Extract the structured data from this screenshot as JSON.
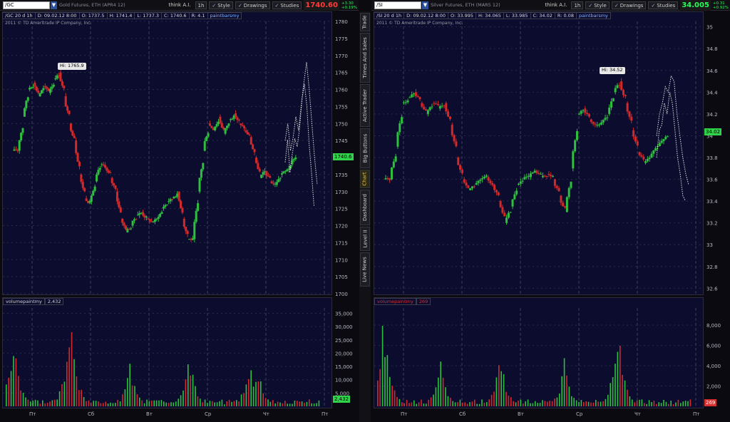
{
  "colors": {
    "up": "#2fbf3f",
    "down": "#d22a2a",
    "grid": "#3e3e5a",
    "projection": "#e0e0e0",
    "last_up": "#22ff55",
    "last_red": "#ff3b3b",
    "badge_green": "#2fd44a",
    "badge_red": "#d83030"
  },
  "toolbar_common": {
    "share_label": "think A.I.",
    "timeframe": "1h",
    "style": "Style",
    "drawings": "Drawings",
    "studies": "Studies"
  },
  "side_tabs": [
    "Trade",
    "Times And Sales",
    "Active Trader",
    "Big Buttons",
    "Chart",
    "Dashboard",
    "Level II",
    "Live News"
  ],
  "active_tab": "Chart",
  "left": {
    "symbol": "/GC",
    "description": "Gold Futures, ETH (APR4 12)",
    "last_price": "1740.60",
    "change_top": "+3.30",
    "change_bottom": "+0.19%",
    "info": [
      "/GC 20 d 1h",
      "D: 09.02.12 8:00",
      "O: 1737.5",
      "H: 1741.4",
      "L: 1737.3",
      "C: 1740.6",
      "R: 4.1",
      "paintbarsmy"
    ],
    "copyright": "2011 © TD Ameritrade IP Company, Inc.",
    "price_badge": "1740.6",
    "hi_label": "Hi: 1765.9",
    "volume_label": "volumepaintmy",
    "volume_value": "2,432",
    "volume_badge": "2,432",
    "price_ticks": [
      "1780",
      "1775",
      "1770",
      "1765",
      "1760",
      "1755",
      "1750",
      "1745",
      "1740",
      "1735",
      "1730",
      "1725",
      "1720",
      "1715",
      "1710",
      "1705",
      "1700"
    ],
    "volume_ticks": [
      "35,000",
      "30,000",
      "25,000",
      "20,000",
      "15,000",
      "10,000",
      "5,000"
    ],
    "day_labels": [
      "Пт",
      "Сб",
      "Вт",
      "Ср",
      "Чт",
      "Пт"
    ]
  },
  "right": {
    "symbol": "/SI",
    "description": "Silver Futures, ETH (MAR5 12)",
    "last_price": "34.005",
    "change_top": "+0.31",
    "change_bottom": "+0.92%",
    "info": [
      "/SI 20 d 1h",
      "D: 09.02.12 8:00",
      "O: 33.995",
      "H: 34.065",
      "L: 33.985",
      "C: 34.02",
      "R: 0.08",
      "paintbarsmy"
    ],
    "copyright": "2011 © TD Ameritrade IP Company, Inc.",
    "price_badge": "34.02",
    "hi_label": "Hi: 34.52",
    "volume_label": "volumepaintmy",
    "volume_value": "269",
    "volume_badge": "269",
    "price_ticks": [
      "35",
      "34.8",
      "34.6",
      "34.4",
      "34.2",
      "34",
      "33.8",
      "33.6",
      "33.4",
      "33.2",
      "33",
      "32.8",
      "32.6"
    ],
    "volume_ticks": [
      "8,000",
      "6,000",
      "4,000",
      "2,000"
    ],
    "day_labels": [
      "Пт",
      "Сб",
      "Вт",
      "Ср",
      "Чт",
      "Пт"
    ]
  },
  "chart_data": [
    {
      "type": "candlestick",
      "symbol": "/GC",
      "ylim": [
        1700,
        1780
      ],
      "y_ticks": [
        1700,
        1705,
        1710,
        1715,
        1720,
        1725,
        1730,
        1735,
        1740,
        1745,
        1750,
        1755,
        1760,
        1765,
        1770,
        1775,
        1780
      ],
      "close_path": [
        1742,
        1752,
        1760,
        1762,
        1758,
        1761,
        1759,
        1763,
        1765,
        1758,
        1750,
        1745,
        1735,
        1728,
        1727,
        1733,
        1738,
        1737,
        1734,
        1730,
        1722,
        1718,
        1720,
        1723,
        1724,
        1722,
        1721,
        1722,
        1725,
        1727,
        1728,
        1730,
        1722,
        1716,
        1716,
        1730,
        1742,
        1750,
        1748,
        1752,
        1747,
        1751,
        1753,
        1750,
        1748,
        1746,
        1740,
        1734,
        1736,
        1733,
        1732,
        1735,
        1736,
        1738,
        1741
      ],
      "projection": [
        1745,
        1750,
        1742,
        1746,
        1752,
        1748,
        1755,
        1762,
        1768,
        1760,
        1750,
        1740,
        1732
      ],
      "hi": 1765.9,
      "last": 1740.6,
      "volume_ylim": [
        0,
        37000
      ],
      "volume_spikes": [
        30000,
        32000,
        35000,
        18000,
        22000,
        21000,
        15000
      ]
    },
    {
      "type": "candlestick",
      "symbol": "/SI",
      "ylim": [
        32.55,
        35.05
      ],
      "y_ticks": [
        32.6,
        32.8,
        33,
        33.2,
        33.4,
        33.6,
        33.8,
        34,
        34.2,
        34.4,
        34.6,
        34.8,
        35
      ],
      "close_path": [
        33.6,
        33.9,
        34.3,
        34.35,
        34.4,
        34.3,
        34.2,
        34.3,
        34.25,
        34.3,
        34.1,
        33.8,
        33.6,
        33.5,
        33.55,
        33.6,
        33.62,
        33.55,
        33.4,
        33.2,
        33.35,
        33.55,
        33.6,
        33.62,
        33.68,
        33.62,
        33.65,
        33.6,
        33.45,
        33.3,
        33.7,
        34.2,
        34.25,
        34.15,
        34.1,
        34.12,
        34.2,
        34.4,
        34.5,
        34.3,
        34.05,
        33.85,
        33.75,
        33.8,
        33.9,
        33.95,
        34.02
      ],
      "projection": [
        34.0,
        34.2,
        34.3,
        34.45,
        34.4,
        34.55,
        34.5,
        34.2,
        34.0,
        33.8,
        33.65,
        33.55
      ],
      "hi": 34.52,
      "last": 34.02,
      "volume_ylim": [
        0,
        9700
      ],
      "volume_spikes": [
        8800,
        6200,
        5200,
        5100,
        6000,
        5000,
        8700
      ]
    }
  ]
}
